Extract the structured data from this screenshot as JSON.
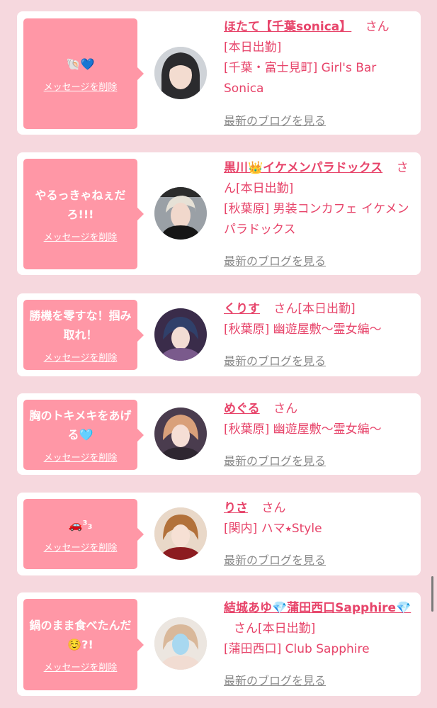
{
  "messages": [
    {
      "message": "🐚💙",
      "delete_label": "メッセージを削除",
      "name": "ほたて【千葉sonica】",
      "honorific": "さん",
      "status": "[本日出勤]",
      "location": "[千葉・富士見町] Girl's Bar Sonica",
      "blog_link": "最新のブログを見る",
      "avatar_icon": "profile-photo-icon"
    },
    {
      "message": "やるっきゃねぇだろ!!!",
      "delete_label": "メッセージを削除",
      "name": "黒川👑イケメンパラドックス",
      "honorific": "さん",
      "status": "[本日出勤]",
      "location": "[秋葉原] 男装コンカフェ イケメンパラドックス",
      "blog_link": "最新のブログを見る",
      "avatar_icon": "profile-photo-icon"
    },
    {
      "message": "勝機を零すな！掴み取れ！",
      "delete_label": "メッセージを削除",
      "name": "くりす",
      "honorific": "さん",
      "status": "[本日出勤]",
      "location": "[秋葉原] 幽遊屋敷〜霊女編〜",
      "blog_link": "最新のブログを見る",
      "avatar_icon": "profile-photo-icon"
    },
    {
      "message": "胸のトキメキをあげる🩵",
      "delete_label": "メッセージを削除",
      "name": "めぐる",
      "honorific": "さん",
      "status": "",
      "location": "[秋葉原] 幽遊屋敷〜霊女編〜",
      "blog_link": "最新のブログを見る",
      "avatar_icon": "profile-photo-icon"
    },
    {
      "message": "🚗³₃",
      "delete_label": "メッセージを削除",
      "name": "りさ",
      "honorific": "さん",
      "status": "",
      "location": "[関内] ハマ⭑Style",
      "blog_link": "最新のブログを見る",
      "avatar_icon": "profile-photo-icon"
    },
    {
      "message": "鍋のまま食べたんだ☺️?!",
      "delete_label": "メッセージを削除",
      "name": "結城あゆ💎蒲田西口Sapphire💎",
      "honorific": "さん",
      "status": "[本日出勤]",
      "location": "[蒲田西口] Club Sapphire",
      "blog_link": "最新のブログを見る",
      "avatar_icon": "profile-photo-icon"
    }
  ],
  "colors": {
    "background": "#f6d8de",
    "bubble": "#ff97a6",
    "accent": "#e7446a",
    "muted": "#8a8a8a"
  }
}
